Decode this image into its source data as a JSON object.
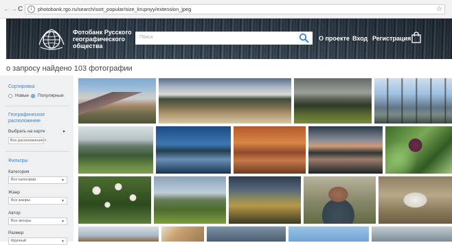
{
  "browser": {
    "url": "photobank.rgo.ru/search/sort_popular/size_krupnyy/extension_jpeg",
    "back": "←",
    "forward": "→",
    "reload": "C",
    "star": "☆"
  },
  "header": {
    "logo_text_line1": "Фотобанк Русского",
    "logo_text_line2": "географического",
    "logo_text_line3": "общества",
    "search_placeholder": "Поиск",
    "nav": [
      "О проекте",
      "Вход",
      "Регистрация"
    ]
  },
  "results_text": "о запросу найдено 103 фотографии",
  "sidebar": {
    "sort_title": "Сортировка",
    "sort_options": [
      "Новые",
      "Популярные"
    ],
    "sort_selected": "Популярные",
    "geo_title_line1": "Географическое",
    "geo_title_line2": "расположение",
    "map_label": "Выбрать на карте",
    "map_arrow": "▸",
    "location_chip": "Все расположения ×",
    "filters_title": "Фильтры",
    "category_label": "Категория",
    "category_value": "Все категории",
    "genre_label": "Жанр",
    "genre_value": "Все жанры",
    "author_label": "Автор",
    "author_value": "Все авторы",
    "size_label": "Размер",
    "size_value": "Крупный"
  },
  "colors": {
    "accent": "#4a7fb8",
    "sidebar_bg": "#eef0f1",
    "search_icon": "#2a7bd0"
  }
}
